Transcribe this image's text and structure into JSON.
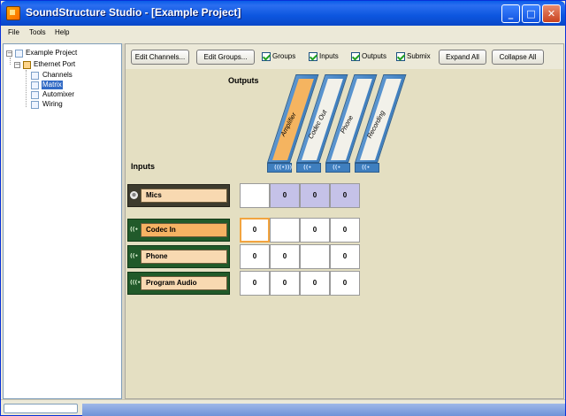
{
  "window": {
    "title": "SoundStructure Studio - [Example Project]",
    "minimize_glyph": "_",
    "maximize_glyph": "□",
    "close_glyph": "✕"
  },
  "menu": [
    "File",
    "Tools",
    "Help"
  ],
  "tree": {
    "root": "Example Project",
    "device": "Ethernet Port",
    "children": [
      "Channels",
      "Matrix",
      "Automixer",
      "Wiring"
    ],
    "selected": "Matrix"
  },
  "toolbar": {
    "edit_channels": "Edit Channels...",
    "edit_groups": "Edit Groups...",
    "checks": [
      "Groups",
      "Inputs",
      "Outputs",
      "Submix"
    ],
    "expand_all": "Expand All",
    "collapse_all": "Collapse All"
  },
  "matrix": {
    "outputs_label": "Outputs",
    "inputs_label": "Inputs",
    "outputs": [
      {
        "name": "Amplifier",
        "icon": "(((•)))",
        "selected": true
      },
      {
        "name": "Codec Out",
        "icon": "((•",
        "selected": false
      },
      {
        "name": "Phone",
        "icon": "((•",
        "selected": false
      },
      {
        "name": "Recording",
        "icon": "((•",
        "selected": false
      }
    ],
    "inputs": [
      {
        "name": "Mics",
        "icon": "⊗",
        "cells": [
          "",
          "0",
          "0",
          "0"
        ]
      },
      {
        "name": "Codec In",
        "icon": "((•",
        "cells": [
          "0",
          "",
          "0",
          "0"
        ]
      },
      {
        "name": "Phone",
        "icon": "((•",
        "cells": [
          "0",
          "0",
          "",
          "0"
        ]
      },
      {
        "name": "Program Audio",
        "icon": "(((•",
        "cells": [
          "0",
          "0",
          "0",
          "0"
        ]
      }
    ]
  },
  "colors": {
    "title_blue": "#0a5de8",
    "output_header": "#3f7fbf",
    "input_green": "#215a2a",
    "selected_orange": "#f6b263",
    "submix_purple": "#c5c2e8"
  }
}
